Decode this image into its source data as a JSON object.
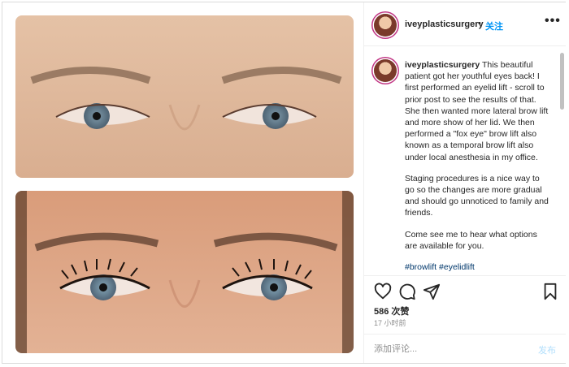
{
  "post": {
    "username": "iveyplasticsurgery",
    "dot": "•",
    "follow_label": "关注",
    "more_label": "•••"
  },
  "caption": {
    "username": "iveyplasticsurgery",
    "paragraph1": "This beautiful patient got her youthful eyes back! I first performed an eyelid lift - scroll to prior post to see the results of that. She then wanted more lateral brow lift and more show of her lid. We then performed a \"fox eye\" brow lift also known as a temporal brow lift also under local anesthesia in my office.",
    "paragraph2": "Staging procedures is a nice way to go so the changes are more gradual and should go unnoticed to family and friends.",
    "paragraph3": "Come see me to hear what options are available for you.",
    "hashtags": "#browlift #eyelidlift"
  },
  "actions": {
    "like_icon": "heart-icon",
    "comment_icon": "comment-icon",
    "share_icon": "paper-plane-icon",
    "save_icon": "bookmark-icon"
  },
  "likes": "586 次赞",
  "time": "17 小时前",
  "comment": {
    "placeholder": "添加评论...",
    "post_label": "发布"
  },
  "colors": {
    "follow": "#0095f6",
    "hashtag": "#00376b",
    "post_disabled": "#b2dffc",
    "border": "#dbdbdb"
  }
}
